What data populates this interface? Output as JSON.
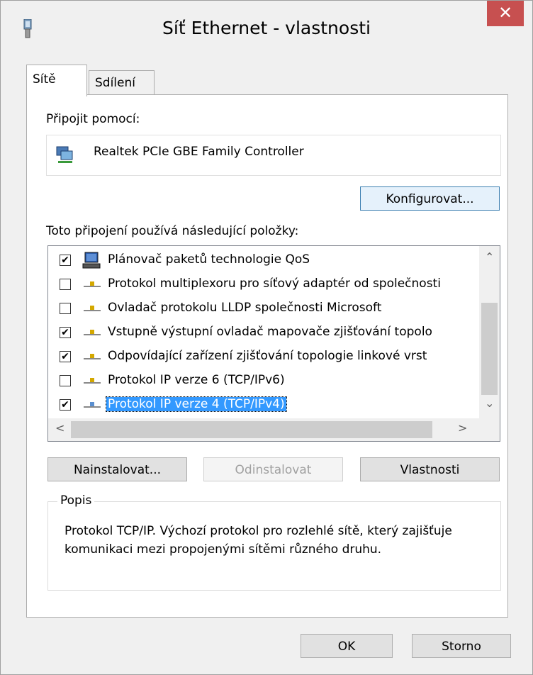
{
  "window": {
    "title": "Síť Ethernet - vlastnosti",
    "close_label": "✕"
  },
  "tabs": [
    {
      "label": "Sítě",
      "active": true
    },
    {
      "label": "Sdílení",
      "active": false
    }
  ],
  "connect_using": {
    "label": "Připojit pomocí:",
    "adapter_name": "Realtek PCIe GBE Family Controller",
    "configure_button": "Konfigurovat..."
  },
  "items_section": {
    "label": "Toto připojení používá následující položky:",
    "items": [
      {
        "label": "Plánovač paketů technologie QoS",
        "checked": true,
        "icon": "qos-scheduler-icon",
        "selected": false
      },
      {
        "label": "Protokol multiplexoru pro síťový adaptér od společnosti",
        "checked": false,
        "icon": "protocol-icon",
        "selected": false
      },
      {
        "label": "Ovladač protokolu LLDP společnosti Microsoft",
        "checked": false,
        "icon": "protocol-icon",
        "selected": false
      },
      {
        "label": "Vstupně výstupní ovladač mapovače zjišťování topolo",
        "checked": true,
        "icon": "protocol-icon",
        "selected": false
      },
      {
        "label": "Odpovídající zařízení zjišťování topologie linkové vrst",
        "checked": true,
        "icon": "protocol-icon",
        "selected": false
      },
      {
        "label": "Protokol IP verze 6 (TCP/IPv6)",
        "checked": false,
        "icon": "protocol-icon",
        "selected": false
      },
      {
        "label": "Protokol IP verze 4 (TCP/IPv4)",
        "checked": true,
        "icon": "protocol-icon",
        "selected": true
      }
    ]
  },
  "item_buttons": {
    "install": "Nainstalovat...",
    "uninstall": "Odinstalovat",
    "properties": "Vlastnosti"
  },
  "description": {
    "legend": "Popis",
    "text": "Protokol TCP/IP. Výchozí protokol pro rozlehlé sítě, který zajišťuje komunikaci mezi propojenými sítěmi různého druhu."
  },
  "footer": {
    "ok": "OK",
    "cancel": "Storno"
  },
  "colors": {
    "selection": "#3399ff",
    "close_button": "#c75050",
    "dialog_bg": "#f0f0f0"
  }
}
